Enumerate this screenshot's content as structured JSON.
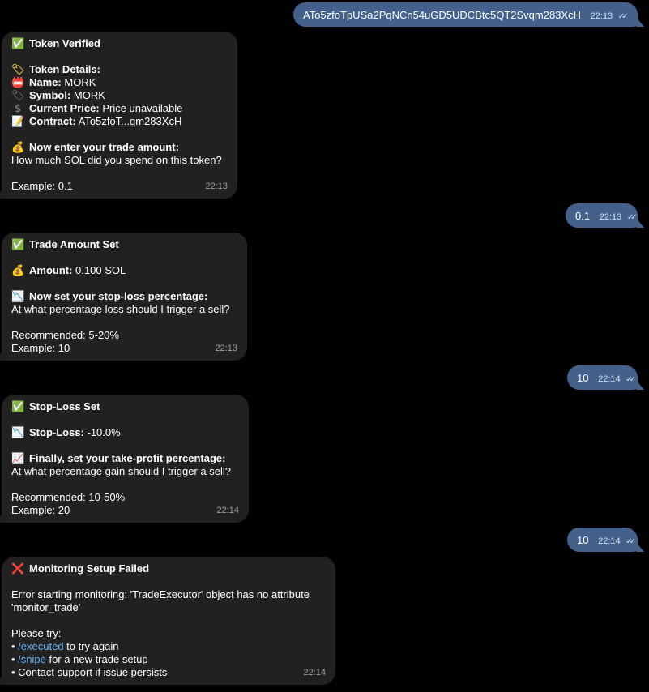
{
  "chat": {
    "out1": {
      "text": "ATo5zfoTpUSa2PqNCn54uGD5UDCBtc5QT2Svqm283XcH",
      "time": "22:13",
      "ticks": "✓✓"
    },
    "msg1": {
      "emoji_title": "✅",
      "title": "Token Verified",
      "emoji_details": "🏷",
      "details_heading": "Token Details:",
      "emoji_name": "📛",
      "name_label": "Name:",
      "name_value": " MORK",
      "emoji_symbol": "🏷",
      "symbol_label": "Symbol:",
      "symbol_value": " MORK",
      "emoji_price": "$",
      "price_label": "Current Price:",
      "price_value": " Price unavailable",
      "emoji_contract": "📝",
      "contract_label": "Contract:",
      "contract_value": " ATo5zfoT...qm283XcH",
      "emoji_amount": "💰",
      "amount_prompt": "Now enter your trade amount:",
      "amount_question": "How much SOL did you spend on this token?",
      "example": "Example: 0.1",
      "time": "22:13"
    },
    "out2": {
      "text": "0.1",
      "time": "22:13",
      "ticks": "✓✓"
    },
    "msg2": {
      "emoji_title": "✅",
      "title": "Trade Amount Set",
      "emoji_amount": "💰",
      "amount_label": "Amount:",
      "amount_value": " 0.100 SOL",
      "emoji_sl": "📉",
      "sl_prompt": "Now set your stop-loss percentage:",
      "sl_question": "At what percentage loss should I trigger a sell?",
      "recommended": "Recommended: 5-20%",
      "example": "Example: 10",
      "time": "22:13"
    },
    "out3": {
      "text": "10",
      "time": "22:14",
      "ticks": "✓✓"
    },
    "msg3": {
      "emoji_title": "✅",
      "title": "Stop-Loss Set",
      "emoji_sl": "📉",
      "sl_label": "Stop-Loss:",
      "sl_value": " -10.0%",
      "emoji_tp": "📈",
      "tp_prompt": "Finally, set your take-profit percentage:",
      "tp_question": "At what percentage gain should I trigger a sell?",
      "recommended": "Recommended: 10-50%",
      "example": "Example: 20",
      "time": "22:14"
    },
    "out4": {
      "text": "10",
      "time": "22:14",
      "ticks": "✓✓"
    },
    "msg4": {
      "emoji_title": "❌",
      "title": "Monitoring Setup Failed",
      "error_line1": "Error starting monitoring: 'TradeExecutor' object has no attribute",
      "error_line2": "'monitor_trade'",
      "please_try": "Please try:",
      "bullet": "• ",
      "cmd1": "/executed",
      "cmd1_rest": " to try again",
      "cmd2": "/snipe",
      "cmd2_rest": " for a new trade setup",
      "support": "Contact support if issue persists",
      "time": "22:14"
    }
  }
}
